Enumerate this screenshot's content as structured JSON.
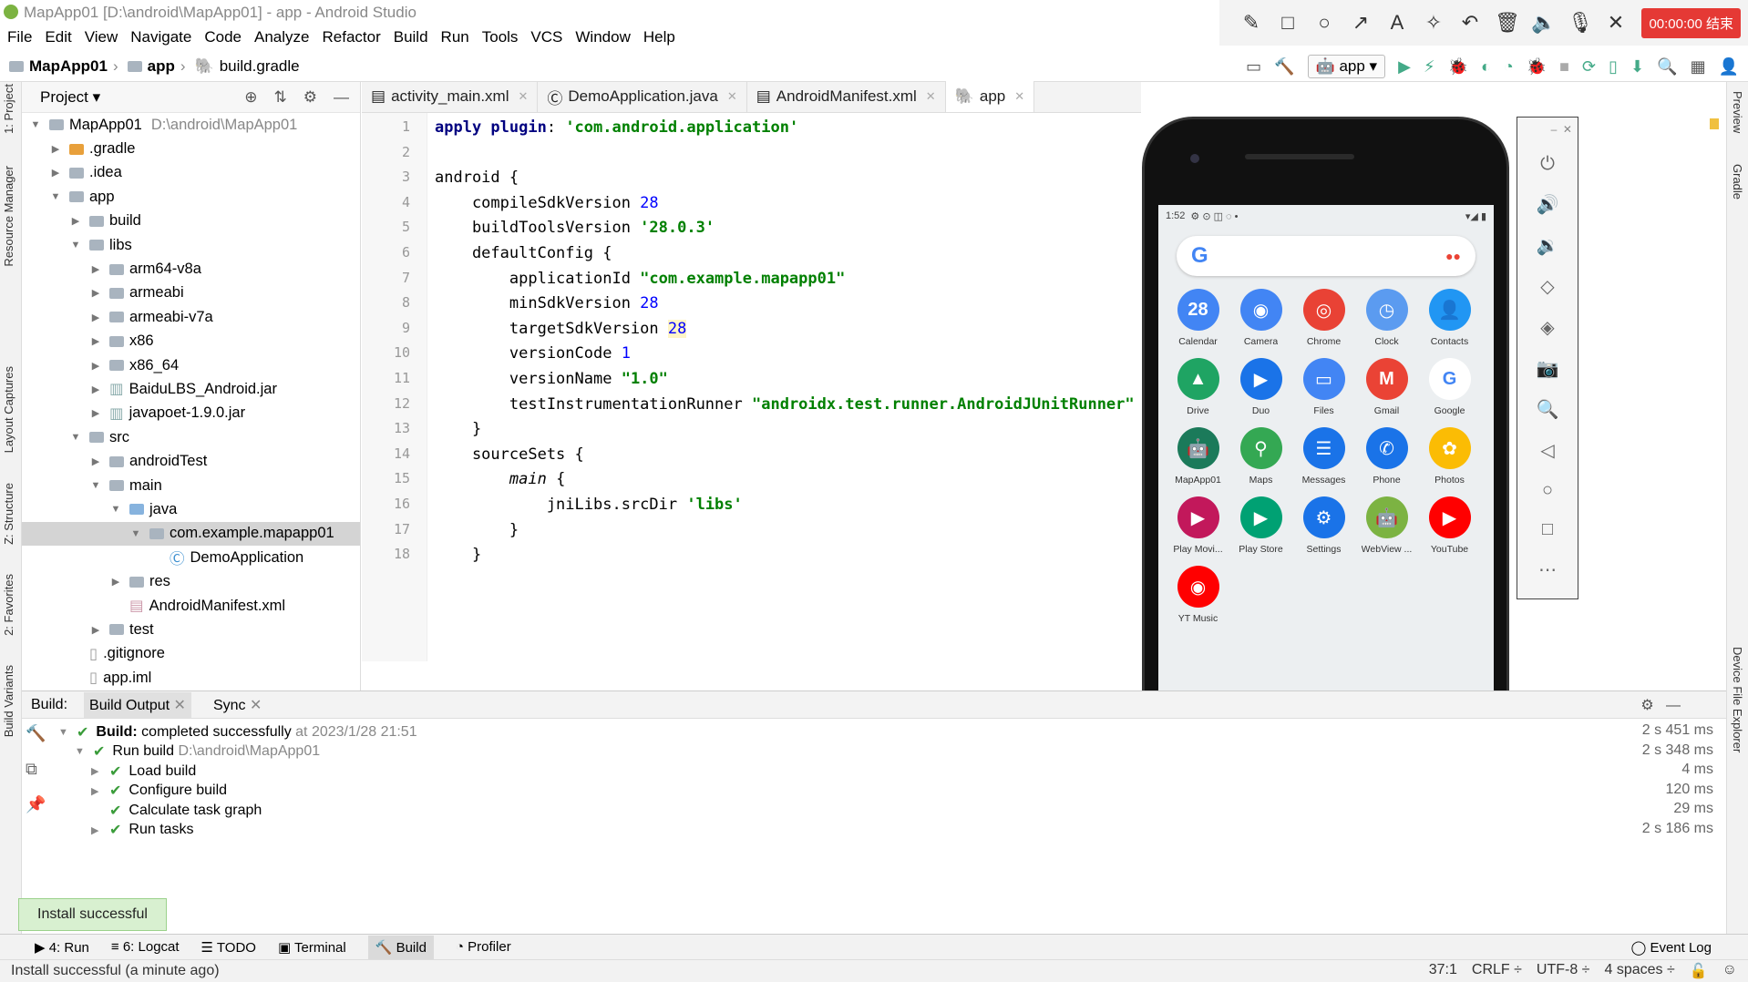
{
  "window": {
    "title": "MapApp01 [D:\\android\\MapApp01] - app - Android Studio"
  },
  "recorder": {
    "timer": "00:00:00 结束",
    "tools": [
      "✎",
      "□",
      "○",
      "↗",
      "A",
      "✧",
      "↶",
      "🗑",
      "🔈",
      "🎙",
      "✕"
    ]
  },
  "menu": [
    "File",
    "Edit",
    "View",
    "Navigate",
    "Code",
    "Analyze",
    "Refactor",
    "Build",
    "Run",
    "Tools",
    "VCS",
    "Window",
    "Help"
  ],
  "breadcrumb": {
    "project": "MapApp01",
    "module": "app",
    "file": "build.gradle"
  },
  "run_config": "app",
  "left_tabs": [
    "1: Project",
    "Resource Manager",
    "Layout Captures",
    "Z: Structure",
    "2: Favorites",
    "Build Variants"
  ],
  "right_tabs": [
    "Preview",
    "Gradle",
    "Device File Explorer"
  ],
  "project_panel": {
    "title": "Project",
    "tree": [
      {
        "label": "MapApp01",
        "extra": "D:\\android\\MapApp01",
        "indent": 0,
        "arrow": "▼",
        "icon": "folder"
      },
      {
        "label": ".gradle",
        "indent": 1,
        "arrow": "▶",
        "icon": "folder-orange"
      },
      {
        "label": ".idea",
        "indent": 1,
        "arrow": "▶",
        "icon": "folder"
      },
      {
        "label": "app",
        "indent": 1,
        "arrow": "▼",
        "icon": "folder"
      },
      {
        "label": "build",
        "indent": 2,
        "arrow": "▶",
        "icon": "folder"
      },
      {
        "label": "libs",
        "indent": 2,
        "arrow": "▼",
        "icon": "folder"
      },
      {
        "label": "arm64-v8a",
        "indent": 3,
        "arrow": "▶",
        "icon": "folder"
      },
      {
        "label": "armeabi",
        "indent": 3,
        "arrow": "▶",
        "icon": "folder"
      },
      {
        "label": "armeabi-v7a",
        "indent": 3,
        "arrow": "▶",
        "icon": "folder"
      },
      {
        "label": "x86",
        "indent": 3,
        "arrow": "▶",
        "icon": "folder"
      },
      {
        "label": "x86_64",
        "indent": 3,
        "arrow": "▶",
        "icon": "folder"
      },
      {
        "label": "BaiduLBS_Android.jar",
        "indent": 3,
        "arrow": "▶",
        "icon": "jar"
      },
      {
        "label": "javapoet-1.9.0.jar",
        "indent": 3,
        "arrow": "▶",
        "icon": "jar"
      },
      {
        "label": "src",
        "indent": 2,
        "arrow": "▼",
        "icon": "folder"
      },
      {
        "label": "androidTest",
        "indent": 3,
        "arrow": "▶",
        "icon": "folder"
      },
      {
        "label": "main",
        "indent": 3,
        "arrow": "▼",
        "icon": "folder"
      },
      {
        "label": "java",
        "indent": 4,
        "arrow": "▼",
        "icon": "folder-blue"
      },
      {
        "label": "com.example.mapapp01",
        "indent": 5,
        "arrow": "▼",
        "icon": "folder",
        "selected": true
      },
      {
        "label": "DemoApplication",
        "indent": 6,
        "arrow": "",
        "icon": "class"
      },
      {
        "label": "res",
        "indent": 4,
        "arrow": "▶",
        "icon": "folder"
      },
      {
        "label": "AndroidManifest.xml",
        "indent": 4,
        "arrow": "",
        "icon": "manifest"
      },
      {
        "label": "test",
        "indent": 3,
        "arrow": "▶",
        "icon": "folder"
      },
      {
        "label": ".gitignore",
        "indent": 2,
        "arrow": "",
        "icon": "file"
      },
      {
        "label": "app.iml",
        "indent": 2,
        "arrow": "",
        "icon": "file"
      }
    ]
  },
  "editor_tabs": [
    {
      "label": "activity_main.xml",
      "icon": "xml"
    },
    {
      "label": "DemoApplication.java",
      "icon": "class"
    },
    {
      "label": "AndroidManifest.xml",
      "icon": "manifest"
    },
    {
      "label": "app",
      "icon": "gradle",
      "active": true
    }
  ],
  "code_lines": [
    {
      "n": "1",
      "html": "<span class=\"kw\">apply plugin</span>: <span class=\"str\">'com.android.application'</span>"
    },
    {
      "n": "2",
      "html": ""
    },
    {
      "n": "3",
      "html": "android {"
    },
    {
      "n": "4",
      "html": "    compileSdkVersion <span class=\"num\">28</span>"
    },
    {
      "n": "5",
      "html": "    buildToolsVersion <span class=\"str\">'28.0.3'</span>"
    },
    {
      "n": "6",
      "html": "    defaultConfig {"
    },
    {
      "n": "7",
      "html": "        applicationId <span class=\"str\">\"com.example.mapapp01\"</span>"
    },
    {
      "n": "8",
      "html": "        minSdkVersion <span class=\"num\">28</span>"
    },
    {
      "n": "9",
      "html": "        targetSdkVersion <span class=\"num hl\">28</span>"
    },
    {
      "n": "10",
      "html": "        versionCode <span class=\"num\">1</span>"
    },
    {
      "n": "11",
      "html": "        versionName <span class=\"str\">\"1.0\"</span>"
    },
    {
      "n": "12",
      "html": "        testInstrumentationRunner <span class=\"str\">\"androidx.test.runner.AndroidJUnitRunner\"</span>"
    },
    {
      "n": "13",
      "html": "    }"
    },
    {
      "n": "14",
      "html": "    sourceSets {"
    },
    {
      "n": "15",
      "html": "        <span class=\"it\">main</span> {"
    },
    {
      "n": "16",
      "html": "            jniLibs.srcDir <span class=\"str\">'libs'</span>"
    },
    {
      "n": "17",
      "html": "        }"
    },
    {
      "n": "18",
      "html": "    }"
    }
  ],
  "build_panel": {
    "label": "Build:",
    "tabs": [
      "Build Output",
      "Sync"
    ],
    "rows": [
      {
        "indent": 0,
        "arrow": "▼",
        "bold": "Build:",
        "text": " completed successfully",
        "dim": " at 2023/1/28 21:51",
        "time": "2 s 451 ms"
      },
      {
        "indent": 1,
        "arrow": "▼",
        "bold": "",
        "text": "Run build ",
        "dim": "D:\\android\\MapApp01",
        "time": "2 s 348 ms"
      },
      {
        "indent": 2,
        "arrow": "▶",
        "bold": "",
        "text": "Load build",
        "dim": "",
        "time": "4 ms"
      },
      {
        "indent": 2,
        "arrow": "▶",
        "bold": "",
        "text": "Configure build",
        "dim": "",
        "time": "120 ms"
      },
      {
        "indent": 2,
        "arrow": "",
        "bold": "",
        "text": "Calculate task graph",
        "dim": "",
        "time": "29 ms"
      },
      {
        "indent": 2,
        "arrow": "▶",
        "bold": "",
        "text": "Run tasks",
        "dim": "",
        "time": "2 s 186 ms"
      }
    ]
  },
  "toast": "Install successful",
  "bottom_tabs": [
    "4: Run",
    "6: Logcat",
    "TODO",
    "Terminal",
    "Build",
    "Profiler"
  ],
  "event_log": "Event Log",
  "status": {
    "message": "Install successful (a minute ago)",
    "position": "37:1",
    "line_sep": "CRLF ÷",
    "encoding": "UTF-8 ÷",
    "indent": "4 spaces ÷"
  },
  "phone": {
    "time": "1:52",
    "apps": [
      {
        "label": "Calendar",
        "color": "#4285f4",
        "glyph": "28"
      },
      {
        "label": "Camera",
        "color": "#4285f4",
        "glyph": "◉"
      },
      {
        "label": "Chrome",
        "color": "#e94235",
        "glyph": "◎"
      },
      {
        "label": "Clock",
        "color": "#5b9bf0",
        "glyph": "◷"
      },
      {
        "label": "Contacts",
        "color": "#2196f3",
        "glyph": "👤"
      },
      {
        "label": "Drive",
        "color": "#1fa463",
        "glyph": "▲"
      },
      {
        "label": "Duo",
        "color": "#1a73e8",
        "glyph": "▶"
      },
      {
        "label": "Files",
        "color": "#4285f4",
        "glyph": "▭"
      },
      {
        "label": "Gmail",
        "color": "#ea4335",
        "glyph": "M"
      },
      {
        "label": "Google",
        "color": "#ffffff",
        "glyph": "G"
      },
      {
        "label": "MapApp01",
        "color": "#1b7a5a",
        "glyph": "🤖"
      },
      {
        "label": "Maps",
        "color": "#34a853",
        "glyph": "⚲"
      },
      {
        "label": "Messages",
        "color": "#1a73e8",
        "glyph": "☰"
      },
      {
        "label": "Phone",
        "color": "#1a73e8",
        "glyph": "✆"
      },
      {
        "label": "Photos",
        "color": "#fbbc04",
        "glyph": "✿"
      },
      {
        "label": "Play Movi...",
        "color": "#c2185b",
        "glyph": "▶"
      },
      {
        "label": "Play Store",
        "color": "#00a173",
        "glyph": "▶"
      },
      {
        "label": "Settings",
        "color": "#1a73e8",
        "glyph": "⚙"
      },
      {
        "label": "WebView ...",
        "color": "#7cb342",
        "glyph": "🤖"
      },
      {
        "label": "YouTube",
        "color": "#ff0000",
        "glyph": "▶"
      },
      {
        "label": "YT Music",
        "color": "#ff0000",
        "glyph": "◉"
      }
    ]
  }
}
